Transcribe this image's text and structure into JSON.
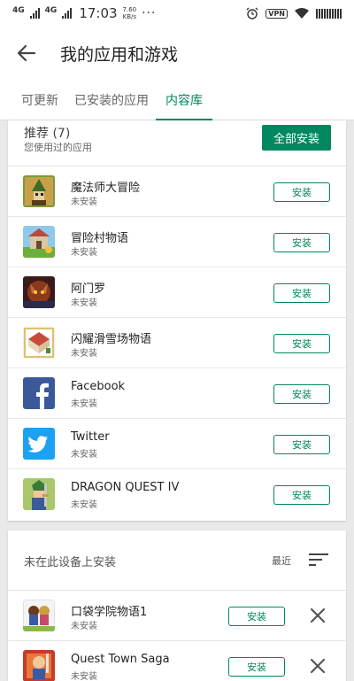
{
  "status_bar": {
    "net1": "4G",
    "net2": "4G",
    "time": "17:03",
    "speed_value": "7.60",
    "speed_unit": "KB/s",
    "more": "···",
    "vpn": "VPN"
  },
  "app_bar": {
    "title": "我的应用和游戏",
    "back_icon": "arrow-left-icon"
  },
  "tabs": [
    {
      "label": "可更新",
      "active": false
    },
    {
      "label": "已安装的应用",
      "active": false
    },
    {
      "label": "内容库",
      "active": true
    }
  ],
  "recommended": {
    "title": "推荐 (7)",
    "subtitle": "您使用过的应用",
    "install_all_label": "全部安装",
    "apps": [
      {
        "name": "魔法师大冒险",
        "status": "未安装",
        "button": "安装",
        "icon": "wizard-game-icon"
      },
      {
        "name": "冒险村物语",
        "status": "未安装",
        "button": "安装",
        "icon": "village-game-icon"
      },
      {
        "name": "阿门罗",
        "status": "未安装",
        "button": "安装",
        "icon": "armello-game-icon"
      },
      {
        "name": "闪耀滑雪场物语",
        "status": "未安装",
        "button": "安装",
        "icon": "ski-resort-game-icon"
      },
      {
        "name": "Facebook",
        "status": "未安装",
        "button": "安装",
        "icon": "facebook-icon"
      },
      {
        "name": "Twitter",
        "status": "未安装",
        "button": "安装",
        "icon": "twitter-icon"
      },
      {
        "name": "DRAGON QUEST IV",
        "status": "未安装",
        "button": "安装",
        "icon": "dragon-quest-icon"
      }
    ]
  },
  "not_installed": {
    "title": "未在此设备上安装",
    "sort_label": "最近",
    "sort_icon": "sort-lines-icon",
    "apps": [
      {
        "name": "口袋学院物语1",
        "status": "未安装",
        "button": "安装",
        "icon": "pocket-academy-icon"
      },
      {
        "name": "Quest Town Saga",
        "status": "未安装",
        "button": "安装",
        "icon": "quest-town-icon"
      }
    ]
  },
  "colors": {
    "accent": "#01875f",
    "facebook": "#3b5998",
    "twitter": "#1da1f2"
  }
}
